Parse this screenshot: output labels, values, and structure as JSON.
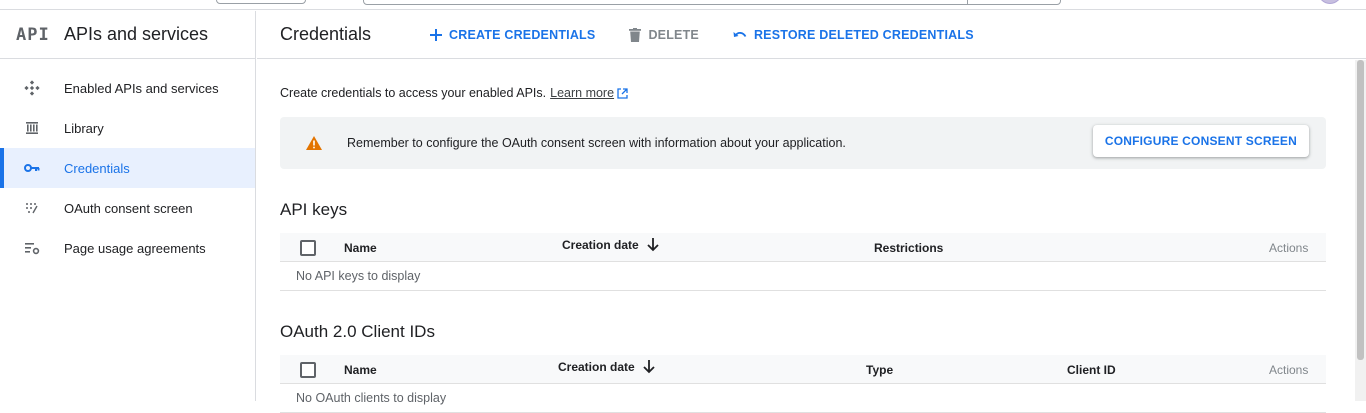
{
  "sidebar": {
    "logo": "API",
    "title": "APIs and services",
    "items": [
      {
        "label": "Enabled APIs and services",
        "icon": "apis-diamond-icon"
      },
      {
        "label": "Library",
        "icon": "library-icon"
      },
      {
        "label": "Credentials",
        "icon": "key-icon",
        "active": true
      },
      {
        "label": "OAuth consent screen",
        "icon": "oauth-dots-icon"
      },
      {
        "label": "Page usage agreements",
        "icon": "settings-list-icon"
      }
    ]
  },
  "toolbar": {
    "title": "Credentials",
    "create_label": "CREATE CREDENTIALS",
    "delete_label": "DELETE",
    "restore_label": "RESTORE DELETED CREDENTIALS"
  },
  "intro": {
    "text": "Create credentials to access your enabled APIs.",
    "link": "Learn more"
  },
  "banner": {
    "message": "Remember to configure the OAuth consent screen with information about your application.",
    "button": "CONFIGURE CONSENT SCREEN"
  },
  "api_keys": {
    "title": "API keys",
    "columns": {
      "name": "Name",
      "created": "Creation date",
      "restrictions": "Restrictions",
      "actions": "Actions"
    },
    "empty": "No API keys to display"
  },
  "oauth": {
    "title": "OAuth 2.0 Client IDs",
    "columns": {
      "name": "Name",
      "created": "Creation date",
      "type": "Type",
      "client_id": "Client ID",
      "actions": "Actions"
    },
    "empty": "No OAuth clients to display"
  },
  "colors": {
    "accent": "#1a73e8",
    "warning": "#e37400",
    "active_bg": "#e8f0fe"
  }
}
